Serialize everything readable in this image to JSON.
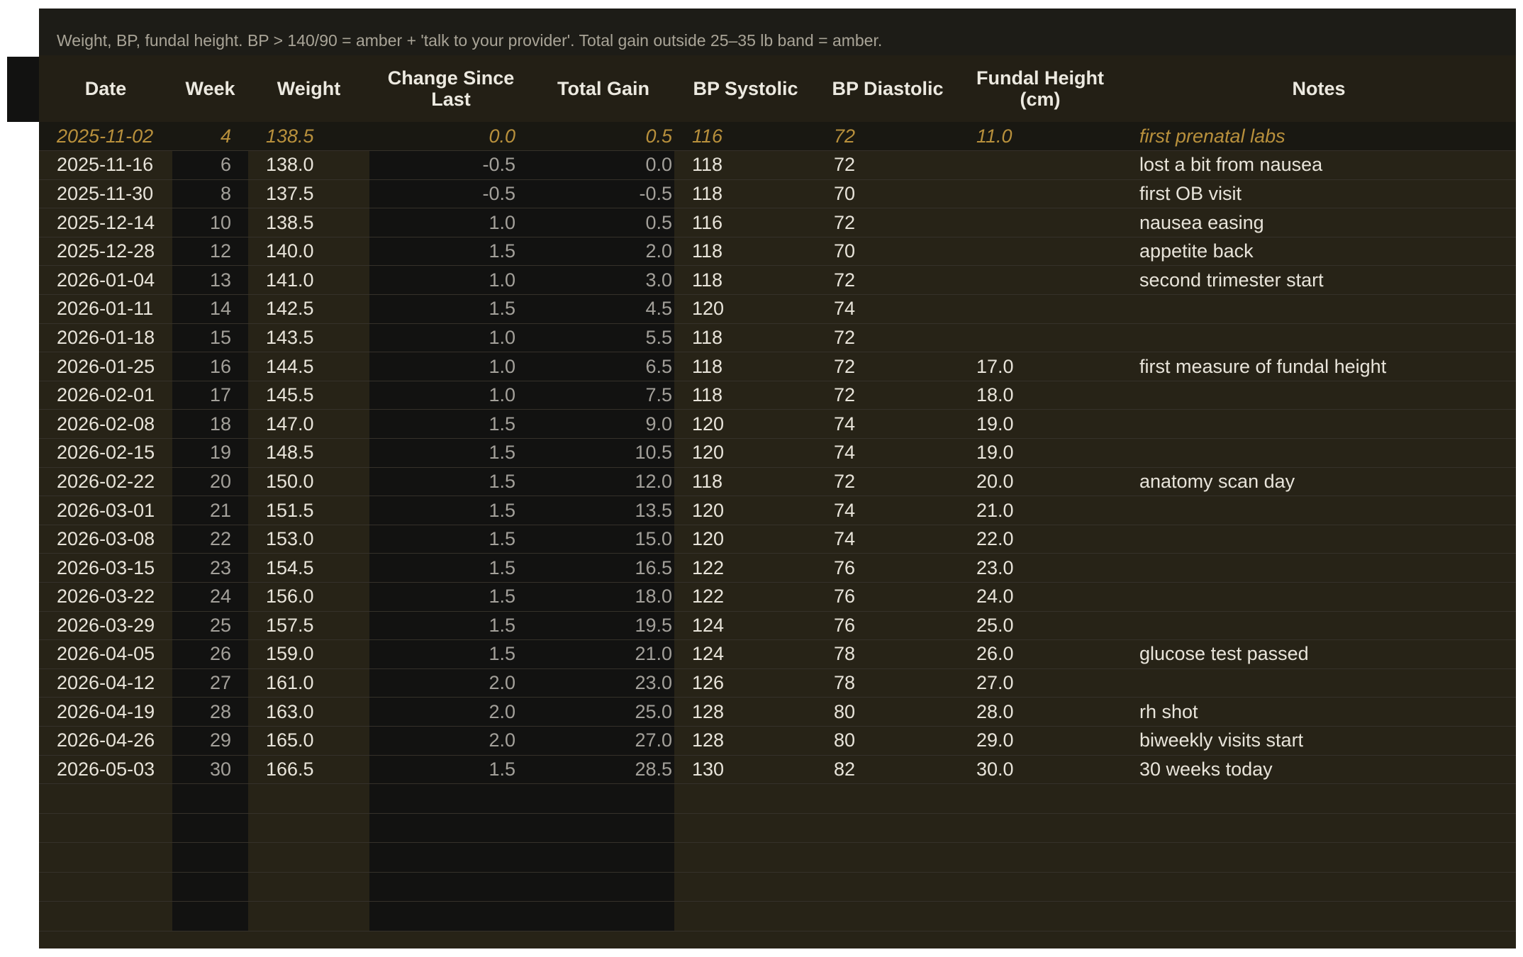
{
  "description": "Weight, BP, fundal height. BP > 140/90 = amber + 'talk to your provider'. Total gain outside 25–35 lb band = amber.",
  "columns": [
    "Date",
    "Week",
    "Weight",
    "Change Since Last",
    "Total Gain",
    "BP Systolic",
    "BP Diastolic",
    "Fundal Height (cm)",
    "Notes"
  ],
  "rows": [
    [
      "2025-11-02",
      "4",
      "138.5",
      "0.0",
      "0.5",
      "116",
      "72",
      "11.0",
      "first prenatal labs"
    ],
    [
      "2025-11-16",
      "6",
      "138.0",
      "-0.5",
      "0.0",
      "118",
      "72",
      "",
      "lost a bit from nausea"
    ],
    [
      "2025-11-30",
      "8",
      "137.5",
      "-0.5",
      "-0.5",
      "118",
      "70",
      "",
      "first OB visit"
    ],
    [
      "2025-12-14",
      "10",
      "138.5",
      "1.0",
      "0.5",
      "116",
      "72",
      "",
      "nausea easing"
    ],
    [
      "2025-12-28",
      "12",
      "140.0",
      "1.5",
      "2.0",
      "118",
      "70",
      "",
      "appetite back"
    ],
    [
      "2026-01-04",
      "13",
      "141.0",
      "1.0",
      "3.0",
      "118",
      "72",
      "",
      "second trimester start"
    ],
    [
      "2026-01-11",
      "14",
      "142.5",
      "1.5",
      "4.5",
      "120",
      "74",
      "",
      ""
    ],
    [
      "2026-01-18",
      "15",
      "143.5",
      "1.0",
      "5.5",
      "118",
      "72",
      "",
      ""
    ],
    [
      "2026-01-25",
      "16",
      "144.5",
      "1.0",
      "6.5",
      "118",
      "72",
      "17.0",
      "first measure of fundal height"
    ],
    [
      "2026-02-01",
      "17",
      "145.5",
      "1.0",
      "7.5",
      "118",
      "72",
      "18.0",
      ""
    ],
    [
      "2026-02-08",
      "18",
      "147.0",
      "1.5",
      "9.0",
      "120",
      "74",
      "19.0",
      ""
    ],
    [
      "2026-02-15",
      "19",
      "148.5",
      "1.5",
      "10.5",
      "120",
      "74",
      "19.0",
      ""
    ],
    [
      "2026-02-22",
      "20",
      "150.0",
      "1.5",
      "12.0",
      "118",
      "72",
      "20.0",
      "anatomy scan day"
    ],
    [
      "2026-03-01",
      "21",
      "151.5",
      "1.5",
      "13.5",
      "120",
      "74",
      "21.0",
      ""
    ],
    [
      "2026-03-08",
      "22",
      "153.0",
      "1.5",
      "15.0",
      "120",
      "74",
      "22.0",
      ""
    ],
    [
      "2026-03-15",
      "23",
      "154.5",
      "1.5",
      "16.5",
      "122",
      "76",
      "23.0",
      ""
    ],
    [
      "2026-03-22",
      "24",
      "156.0",
      "1.5",
      "18.0",
      "122",
      "76",
      "24.0",
      ""
    ],
    [
      "2026-03-29",
      "25",
      "157.5",
      "1.5",
      "19.5",
      "124",
      "76",
      "25.0",
      ""
    ],
    [
      "2026-04-05",
      "26",
      "159.0",
      "1.5",
      "21.0",
      "124",
      "78",
      "26.0",
      "glucose test passed"
    ],
    [
      "2026-04-12",
      "27",
      "161.0",
      "2.0",
      "23.0",
      "126",
      "78",
      "27.0",
      ""
    ],
    [
      "2026-04-19",
      "28",
      "163.0",
      "2.0",
      "25.0",
      "128",
      "80",
      "28.0",
      "rh shot"
    ],
    [
      "2026-04-26",
      "29",
      "165.0",
      "2.0",
      "27.0",
      "128",
      "80",
      "29.0",
      "biweekly visits start"
    ],
    [
      "2026-05-03",
      "30",
      "166.5",
      "1.5",
      "28.5",
      "130",
      "82",
      "30.0",
      "30 weeks today"
    ]
  ],
  "empty_rows": 5,
  "colors": {
    "panel": "#272317",
    "dark_column": "#121211",
    "amber_highlight": "#b8903c",
    "header_text": "#ece9e0"
  }
}
